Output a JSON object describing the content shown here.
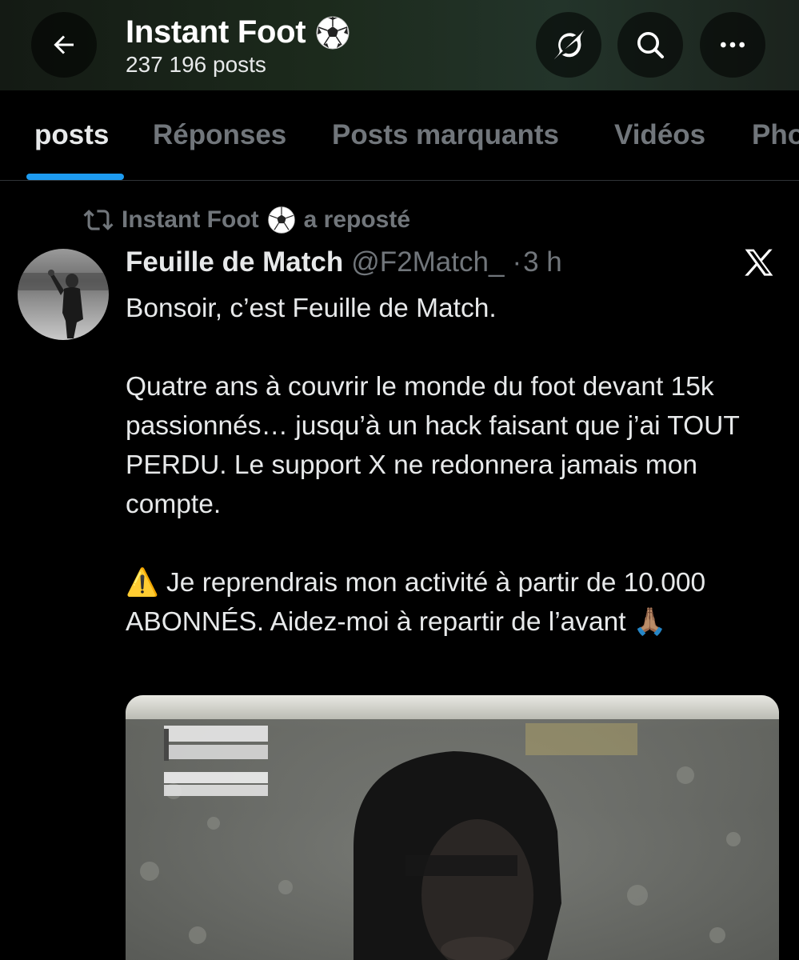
{
  "header": {
    "title": "Instant Foot",
    "title_emoji": "soccer-ball-icon",
    "posts_count": "237 196 posts",
    "back_icon": "arrow-left-icon",
    "grok_icon": "grok-icon",
    "search_icon": "search-icon",
    "more_icon": "more-horizontal-icon"
  },
  "tabs": [
    {
      "label": "posts",
      "active": true
    },
    {
      "label": "Réponses",
      "active": false
    },
    {
      "label": "Posts marquants",
      "active": false
    },
    {
      "label": "Vidéos",
      "active": false
    },
    {
      "label": "Photos",
      "active": false
    }
  ],
  "repost": {
    "icon": "repost-icon",
    "name": "Instant Foot",
    "suffix": "a reposté"
  },
  "post": {
    "author_name": "Feuille de Match",
    "handle": "@F2Match_",
    "separator": "·",
    "time": "3 h",
    "source_icon": "x-logo-icon",
    "paragraphs": [
      "Bonsoir, c’est Feuille de Match.",
      "Quatre ans à couvrir le monde du foot devant 15k passionnés… jusqu’à un hack faisant que j’ai TOUT PERDU. Le support X ne redonnera jamais mon compte.",
      "⚠️ Je reprendrais mon activité à partir de 10.000 ABONNÉS. Aidez-moi à repartir de l’avant 🙏🏽"
    ]
  },
  "colors": {
    "background": "#000000",
    "text_primary": "#e7e9ea",
    "text_secondary": "#71767b",
    "accent": "#1d9bf0",
    "divider": "#2f3336"
  }
}
